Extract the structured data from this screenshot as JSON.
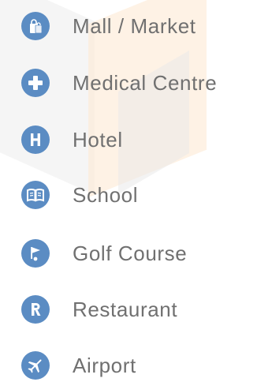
{
  "legend": {
    "accent_color": "#5b8cc3",
    "items": [
      {
        "icon": "shopping-bag-icon",
        "label": "Mall / Market"
      },
      {
        "icon": "plus-cross-icon",
        "label": "Medical Centre"
      },
      {
        "icon": "hotel-h-icon",
        "label": "Hotel"
      },
      {
        "icon": "open-book-icon",
        "label": "School"
      },
      {
        "icon": "golf-flag-icon",
        "label": "Golf Course"
      },
      {
        "icon": "restaurant-r-icon",
        "label": "Restaurant"
      },
      {
        "icon": "airplane-icon",
        "label": "Airport"
      }
    ]
  }
}
